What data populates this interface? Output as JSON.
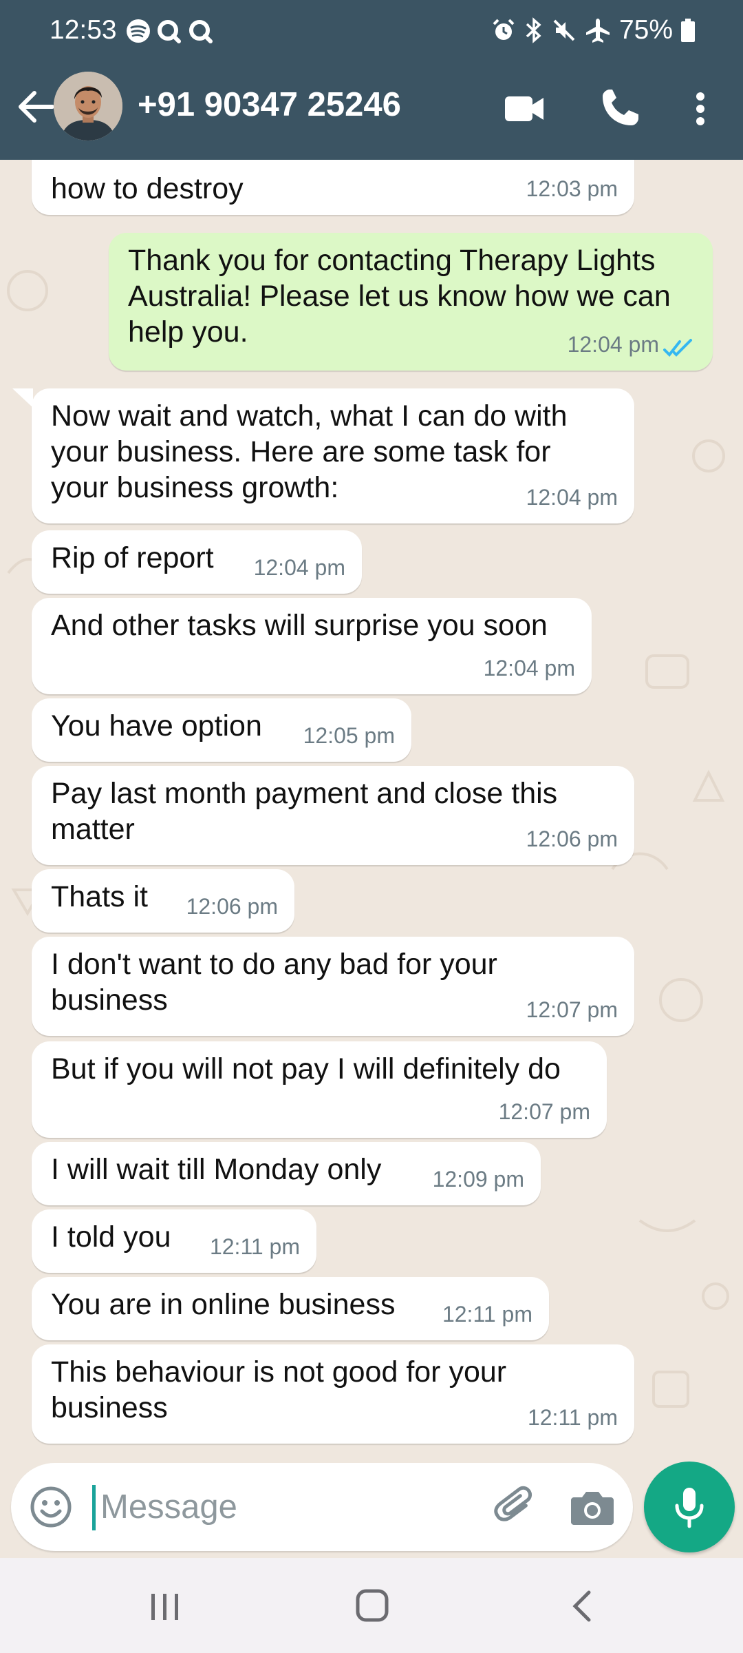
{
  "status_bar": {
    "time": "12:53",
    "battery_percent": "75%",
    "left_icons": [
      "spotify-icon",
      "search-icon",
      "search-icon"
    ],
    "right_icons": [
      "alarm-icon",
      "bluetooth-icon",
      "mute-icon",
      "airplane-icon",
      "battery-icon"
    ]
  },
  "header": {
    "contact_name": "+91 90347 25246",
    "icons": [
      "back-arrow-icon",
      "video-call-icon",
      "phone-call-icon",
      "more-options-icon"
    ]
  },
  "colors": {
    "header_bg": "#3b5463",
    "chat_bg": "#efe7de",
    "incoming_bubble": "#ffffff",
    "outgoing_bubble": "#dcf8c6",
    "read_ticks": "#34b7f1",
    "mic_button": "#14a885"
  },
  "messages": [
    {
      "text": "how to destroy",
      "time": "12:03 pm",
      "direction": "in"
    },
    {
      "text": "Thank you for contacting Therapy Lights Australia! Please let us know how we can help you.",
      "time": "12:04 pm",
      "direction": "out",
      "status": "read"
    },
    {
      "text": "Now wait and watch, what I can do with your business. Here are some task for your business growth:",
      "time": "12:04 pm",
      "direction": "in"
    },
    {
      "text": "Rip of report",
      "time": "12:04 pm",
      "direction": "in"
    },
    {
      "text": "And other tasks will surprise you soon",
      "time": "12:04 pm",
      "direction": "in"
    },
    {
      "text": "You have option",
      "time": "12:05 pm",
      "direction": "in"
    },
    {
      "text": "Pay last month payment and close this matter",
      "time": "12:06 pm",
      "direction": "in"
    },
    {
      "text": "Thats it",
      "time": "12:06 pm",
      "direction": "in"
    },
    {
      "text": "I don't want to do any bad for your business",
      "time": "12:07 pm",
      "direction": "in"
    },
    {
      "text": "But if you will not pay I will definitely do",
      "time": "12:07 pm",
      "direction": "in"
    },
    {
      "text": "I will wait till Monday only",
      "time": "12:09 pm",
      "direction": "in"
    },
    {
      "text": "I told you",
      "time": "12:11 pm",
      "direction": "in"
    },
    {
      "text": "You are in online business",
      "time": "12:11 pm",
      "direction": "in"
    },
    {
      "text": "This behaviour is not good for your business",
      "time": "12:11 pm",
      "direction": "in"
    }
  ],
  "composer": {
    "placeholder": "Message",
    "icons": [
      "emoji-icon",
      "attach-icon",
      "camera-icon",
      "mic-icon"
    ]
  },
  "nav_bar": {
    "icons": [
      "recents-icon",
      "home-icon",
      "back-icon"
    ]
  }
}
